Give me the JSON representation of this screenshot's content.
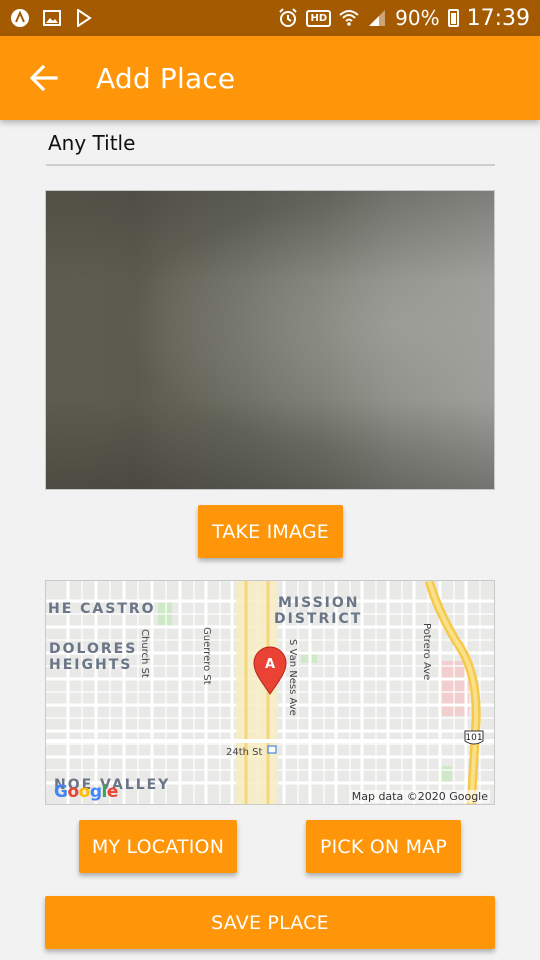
{
  "status_bar": {
    "battery": "90%",
    "time": "17:39",
    "hd_badge": "HD",
    "icons": [
      "app-icon",
      "image-icon",
      "play-store-icon",
      "alarm-icon",
      "hd-icon",
      "wifi-icon",
      "signal-icon",
      "battery-icon"
    ]
  },
  "app_bar": {
    "title": "Add Place",
    "back_icon": "arrow-left-icon"
  },
  "form": {
    "title_value": "Any Title",
    "take_image_label": "TAKE IMAGE",
    "my_location_label": "MY LOCATION",
    "pick_on_map_label": "PICK ON MAP",
    "save_place_label": "SAVE PLACE"
  },
  "map": {
    "attribution": "Map data ©2020 Google",
    "google_logo": [
      "G",
      "o",
      "o",
      "g",
      "l",
      "e"
    ],
    "marker_label": "A",
    "labels": {
      "castro": "HE CASTRO",
      "mission": "MISSION",
      "district": "DISTRICT",
      "dolores": "DOLORES",
      "heights": "HEIGHTS",
      "church": "Church St",
      "guerrero": "Guerrero St",
      "van_ness": "S Van Ness Ave",
      "potrero": "Potrero Ave",
      "24th": "24th St",
      "noe": "NOE VALLEY",
      "highway": "101"
    }
  },
  "colors": {
    "accent": "#ff9508",
    "status_bar": "#a45a00",
    "background": "#f2f2f2"
  }
}
